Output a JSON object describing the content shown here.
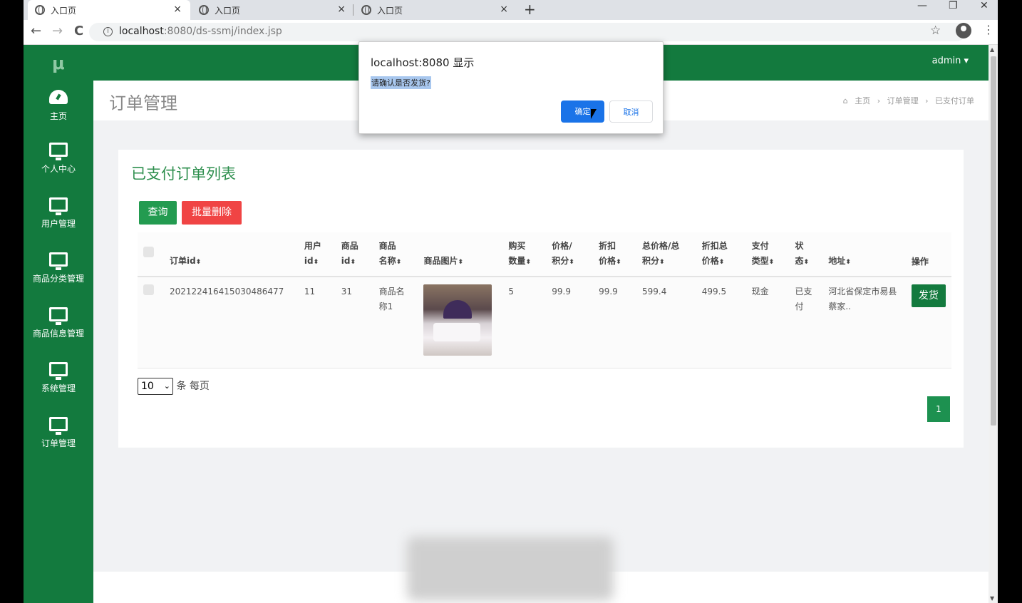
{
  "browser": {
    "tabs": [
      {
        "title": "入口页",
        "close": "×"
      },
      {
        "title": "入口页",
        "close": "×"
      },
      {
        "title": "入口页",
        "close": "×"
      }
    ],
    "new_tab": "+",
    "window_controls": {
      "minimize": "—",
      "restore": "❐",
      "close": "✕"
    },
    "nav": {
      "back": "←",
      "forward": "→",
      "reload": "C"
    },
    "url_host": "localhost",
    "url_rest": ":8080/ds-ssmj/index.jsp",
    "star": "☆",
    "menu": "⋮"
  },
  "app": {
    "logo": "μ",
    "user": "admin ▾",
    "sidebar": [
      {
        "label": "主页",
        "icon": "dashboard-icon"
      },
      {
        "label": "个人中心",
        "icon": "monitor-icon"
      },
      {
        "label": "用户管理",
        "icon": "monitor-icon"
      },
      {
        "label": "商品分类管理",
        "icon": "monitor-icon"
      },
      {
        "label": "商品信息管理",
        "icon": "monitor-icon"
      },
      {
        "label": "系统管理",
        "icon": "monitor-icon"
      },
      {
        "label": "订单管理",
        "icon": "monitor-icon"
      }
    ],
    "page_title": "订单管理",
    "breadcrumb": [
      "主页",
      "订单管理",
      "已支付订单"
    ],
    "card_title": "已支付订单列表",
    "buttons": {
      "query": "查询",
      "batch_delete": "批量删除"
    },
    "table": {
      "headers": [
        {
          "l1": "订单id",
          "l2": ""
        },
        {
          "l1": "用户",
          "l2": "id"
        },
        {
          "l1": "商品",
          "l2": "id"
        },
        {
          "l1": "商品",
          "l2": "名称"
        },
        {
          "l1": "商品图片",
          "l2": ""
        },
        {
          "l1": "购买",
          "l2": "数量"
        },
        {
          "l1": "价格/",
          "l2": "积分"
        },
        {
          "l1": "折扣",
          "l2": "价格"
        },
        {
          "l1": "总价格/总",
          "l2": "积分"
        },
        {
          "l1": "折扣总",
          "l2": "价格"
        },
        {
          "l1": "支付",
          "l2": "类型"
        },
        {
          "l1": "状",
          "l2": "态"
        },
        {
          "l1": "地址",
          "l2": ""
        },
        {
          "l1": "操作",
          "l2": ""
        }
      ],
      "rows": [
        {
          "order_id": "202122416415030486477",
          "user_id": "11",
          "product_id": "31",
          "product_name": "商品名称1",
          "quantity": "5",
          "price": "99.9",
          "discount_price": "99.9",
          "total": "599.4",
          "discount_total": "499.5",
          "pay_type": "现金",
          "status": "已支付",
          "address": "河北省保定市易县蔡家..",
          "action": "发货"
        }
      ]
    },
    "page_size": {
      "value": "10",
      "suffix": "条 每页"
    },
    "pagination": [
      "1"
    ]
  },
  "dialog": {
    "title": "localhost:8080 显示",
    "message": "请确认是否发货?",
    "ok": "确定",
    "cancel": "取消"
  },
  "colors": {
    "brand_green": "#137a3e",
    "danger_red": "#f04444",
    "dialog_blue": "#1a73e8"
  }
}
